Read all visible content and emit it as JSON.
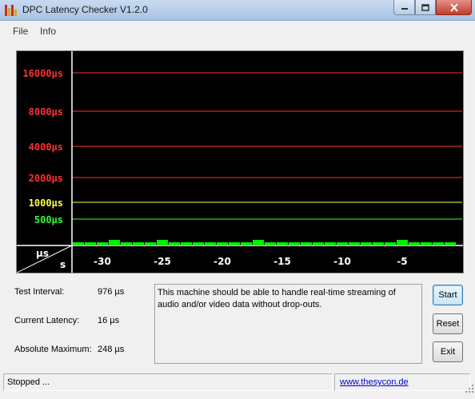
{
  "window": {
    "title": "DPC Latency Checker V1.2.0",
    "controls": {
      "minimize_icon": "minimize-icon",
      "maximize_icon": "maximize-icon",
      "close_icon": "close-icon"
    }
  },
  "menu": {
    "file": "File",
    "info": "Info"
  },
  "chart_data": {
    "type": "bar",
    "title": "",
    "background": "#000000",
    "y_axis": {
      "unit_label": "µs",
      "scale": "log",
      "ticks": [
        {
          "label": "16000µs",
          "value": 16000,
          "color": "#ff3030"
        },
        {
          "label": "8000µs",
          "value": 8000,
          "color": "#ff3030"
        },
        {
          "label": "4000µs",
          "value": 4000,
          "color": "#ff3030"
        },
        {
          "label": "2000µs",
          "value": 2000,
          "color": "#ff3030"
        },
        {
          "label": "1000µs",
          "value": 1000,
          "color": "#ffff40"
        },
        {
          "label": "500µs",
          "value": 500,
          "color": "#30ff30"
        }
      ]
    },
    "x_axis": {
      "unit_label": "s",
      "ticks": [
        {
          "label": "-30",
          "value": -30
        },
        {
          "label": "-25",
          "value": -25
        },
        {
          "label": "-20",
          "value": -20
        },
        {
          "label": "-15",
          "value": -15
        },
        {
          "label": "-10",
          "value": -10
        },
        {
          "label": "-5",
          "value": -5
        }
      ],
      "range": [
        -32.5,
        0
      ]
    },
    "bar_color": "#00ee00",
    "series": [
      {
        "x": [
          -32,
          -31,
          -30,
          -29,
          -28,
          -27,
          -26,
          -25,
          -24,
          -23,
          -22,
          -21,
          -20,
          -19,
          -18,
          -17,
          -16,
          -15,
          -14,
          -13,
          -12,
          -11,
          -10,
          -9,
          -8,
          -7,
          -6,
          -5,
          -4,
          -3,
          -2,
          -1
        ],
        "values": [
          16,
          16,
          16,
          24,
          16,
          16,
          16,
          24,
          16,
          16,
          16,
          16,
          16,
          16,
          16,
          24,
          16,
          16,
          16,
          16,
          16,
          16,
          16,
          16,
          16,
          16,
          16,
          24,
          16,
          16,
          16,
          16
        ]
      }
    ]
  },
  "info": {
    "test_interval_label": "Test Interval:",
    "test_interval_value": "976 µs",
    "current_latency_label": "Current Latency:",
    "current_latency_value": "16 µs",
    "absolute_max_label": "Absolute Maximum:",
    "absolute_max_value": "248 µs",
    "message": "This machine should be able to handle real-time streaming of audio and/or video data without drop-outs."
  },
  "buttons": {
    "start": "Start",
    "reset": "Reset",
    "exit": "Exit"
  },
  "status": {
    "text": "Stopped ...",
    "link": "www.thesycon.de"
  }
}
